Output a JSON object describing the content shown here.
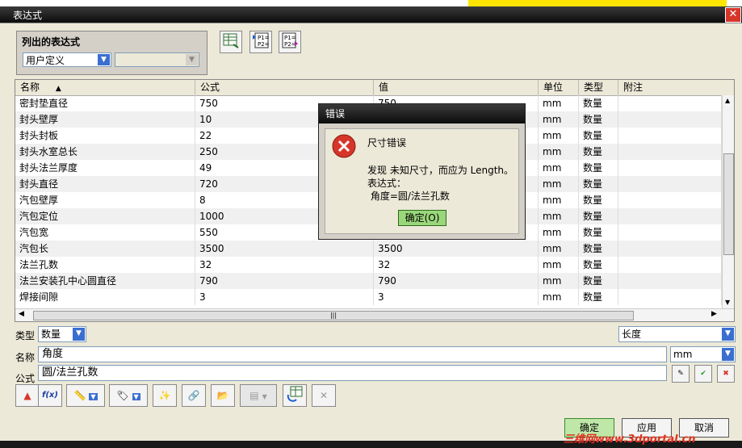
{
  "window": {
    "title": "表达式",
    "close": "✕"
  },
  "listed": {
    "label": "列出的表达式",
    "filter": "用户定义",
    "secondary": ""
  },
  "table": {
    "headers": [
      "名称",
      "公式",
      "值",
      "单位",
      "类型",
      "附注"
    ],
    "rows": [
      [
        "密封垫直径",
        "750",
        "750",
        "mm",
        "数量",
        ""
      ],
      [
        "封头壁厚",
        "10",
        "",
        "mm",
        "数量",
        ""
      ],
      [
        "封头封板",
        "22",
        "",
        "mm",
        "数量",
        ""
      ],
      [
        "封头水室总长",
        "250",
        "",
        "mm",
        "数量",
        ""
      ],
      [
        "封头法兰厚度",
        "49",
        "",
        "mm",
        "数量",
        ""
      ],
      [
        "封头直径",
        "720",
        "",
        "mm",
        "数量",
        ""
      ],
      [
        "汽包壁厚",
        "8",
        "",
        "mm",
        "数量",
        ""
      ],
      [
        "汽包定位",
        "1000",
        "",
        "mm",
        "数量",
        ""
      ],
      [
        "汽包宽",
        "550",
        "",
        "mm",
        "数量",
        ""
      ],
      [
        "汽包长",
        "3500",
        "3500",
        "mm",
        "数量",
        ""
      ],
      [
        "法兰孔数",
        "32",
        "32",
        "mm",
        "数量",
        ""
      ],
      [
        "法兰安装孔中心圆直径",
        "790",
        "790",
        "mm",
        "数量",
        ""
      ],
      [
        "焊接间隙",
        "3",
        "3",
        "mm",
        "数量",
        ""
      ]
    ]
  },
  "form": {
    "type_label": "类型",
    "type_value": "数量",
    "dimension": "长度",
    "name_label": "名称",
    "name_value": "角度",
    "unit": "mm",
    "formula_label": "公式",
    "formula_value": "圆/法兰孔数"
  },
  "buttons": {
    "ok": "确定",
    "apply": "应用",
    "cancel": "取消"
  },
  "error": {
    "title": "错误",
    "heading": "尺寸错误",
    "line1": "发现 未知尺寸，而应为 Length。",
    "line2": "表达式：",
    "line3": " 角度=圆/法兰孔数",
    "ok": "确定(O)"
  },
  "watermark": "三维网www.3dportal.cn",
  "colors": {
    "accent_green": "#5fbf3a",
    "error_red": "#d7352a",
    "title_dark": "#0c0c0c"
  }
}
